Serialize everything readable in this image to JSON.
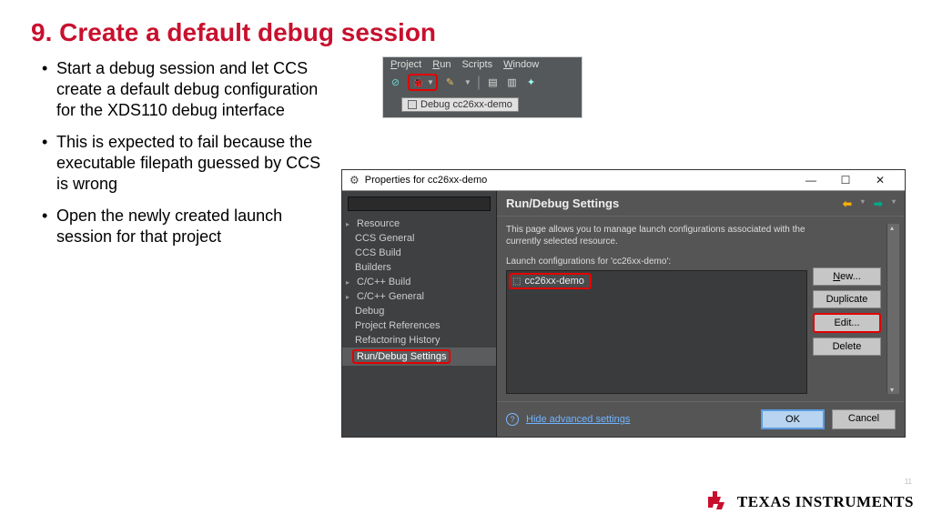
{
  "slide": {
    "title": "9. Create a default debug session",
    "bullets": [
      "Start a debug session and let CCS create a default debug configuration for the XDS110 debug interface",
      "This is expected to fail because the executable filepath guessed by CCS is wrong",
      "Open the newly created launch session for that project"
    ]
  },
  "toolbar": {
    "menu": {
      "project": "Project",
      "run": "Run",
      "scripts": "Scripts",
      "window": "Window"
    },
    "tab_label": "Debug cc26xx-demo"
  },
  "dialog": {
    "title": "Properties for cc26xx-demo",
    "tree": {
      "resource": "Resource",
      "ccs_general": "CCS General",
      "ccs_build": "CCS Build",
      "builders": "Builders",
      "cpp_build": "C/C++ Build",
      "cpp_general": "C/C++ General",
      "debug": "Debug",
      "project_refs": "Project References",
      "refactor": "Refactoring History",
      "run_debug": "Run/Debug Settings"
    },
    "right": {
      "header": "Run/Debug Settings",
      "desc": "This page allows you to manage launch configurations associated with the currently selected resource.",
      "lc_label": "Launch configurations for 'cc26xx-demo':",
      "lc_item": "cc26xx-demo",
      "buttons": {
        "new": "New...",
        "duplicate": "Duplicate",
        "edit": "Edit...",
        "delete": "Delete"
      }
    },
    "footer": {
      "link": "Hide advanced settings",
      "ok": "OK",
      "cancel": "Cancel"
    }
  },
  "branding": {
    "company": "TEXAS INSTRUMENTS",
    "page": "11"
  }
}
